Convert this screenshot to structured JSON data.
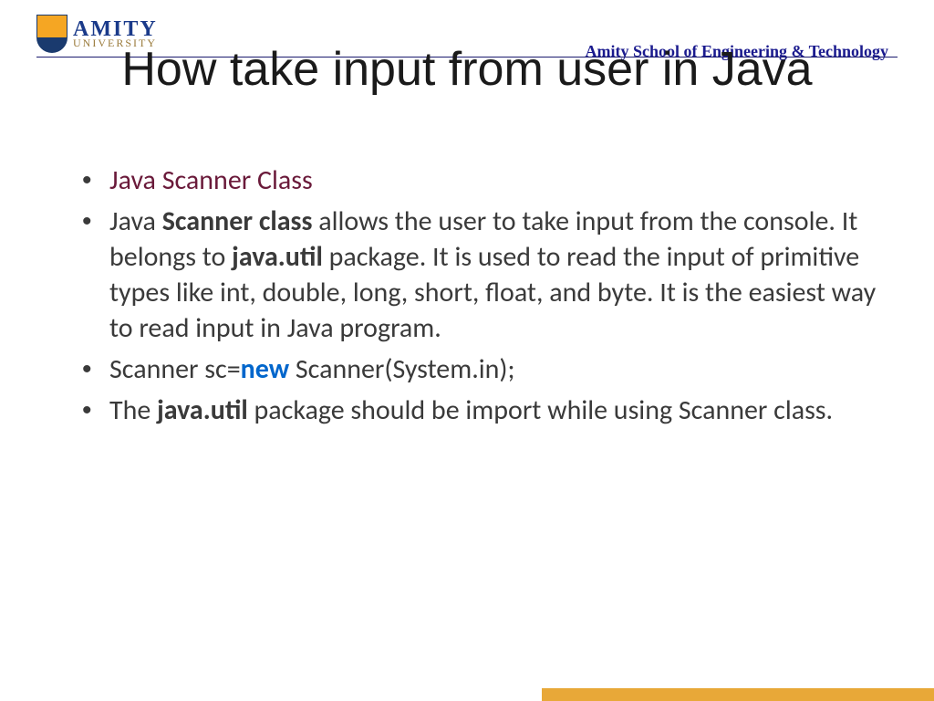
{
  "header": {
    "logo_main": "AMITY",
    "logo_sub": "UNIVERSITY",
    "school": "Amity School of Engineering & Technology"
  },
  "slide": {
    "title": "How take input from user in Java"
  },
  "bullets": {
    "b1": "Java Scanner Class",
    "b2": {
      "pre": "Java ",
      "bold1": "Scanner class",
      "mid1": " allows the user to take input from the console. It belongs to ",
      "bold2": "java.util",
      "mid2": " package. It is used to read the input of primitive types like int, double, long, short, float, and byte. It is the easiest way to read input in Java program."
    },
    "b3": {
      "pre": "Scanner sc=",
      "kw": "new",
      "post": " Scanner(System.in);"
    },
    "b4": {
      "pre": "The ",
      "bold1": "java.util",
      "post": " package should be import while using Scanner class."
    }
  }
}
